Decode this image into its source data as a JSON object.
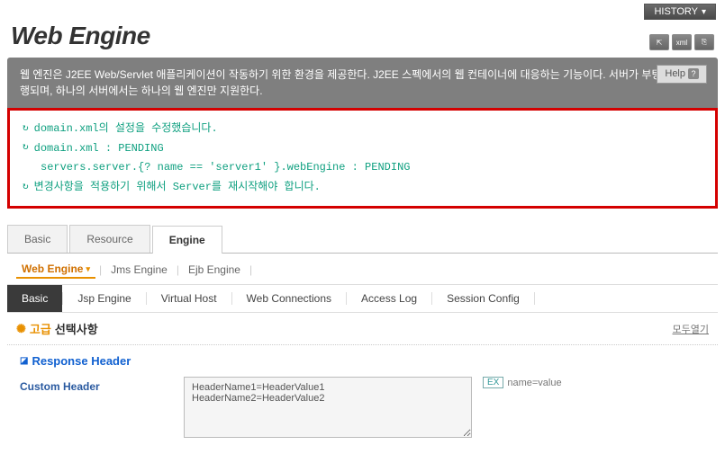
{
  "top": {
    "history": "HISTORY"
  },
  "page_title": "Web Engine",
  "description": "웹 엔진은 J2EE Web/Servlet 애플리케이션이 작동하기 위한 환경을 제공한다. J2EE 스펙에서의 웹 컨테이너에 대응하는 기능이다. 서버가 부팅될 때 실행되며, 하나의 서버에서는 하나의 웹 엔진만 지원한다.",
  "help_label": "Help",
  "messages": {
    "line1": "domain.xml의 설정을 수정했습니다.",
    "line2": "domain.xml : PENDING",
    "line3": "servers.server.{? name == 'server1' }.webEngine : PENDING",
    "line4": "변경사항을 적용하기 위해서 Server를 재시작해야 합니다."
  },
  "tabs1": {
    "basic": "Basic",
    "resource": "Resource",
    "engine": "Engine"
  },
  "tabs2": {
    "web": "Web Engine",
    "jms": "Jms Engine",
    "ejb": "Ejb Engine"
  },
  "tabs3": {
    "basic": "Basic",
    "jsp": "Jsp Engine",
    "vhost": "Virtual Host",
    "webconn": "Web Connections",
    "access": "Access Log",
    "session": "Session Config"
  },
  "section": {
    "advanced": "고급",
    "options": "선택사항",
    "expand_all": "모두열기"
  },
  "subsection": {
    "title": "Response Header"
  },
  "form": {
    "custom_header_label": "Custom Header",
    "custom_header_value": "HeaderName1=HeaderValue1\nHeaderName2=HeaderValue2",
    "example_badge": "EX",
    "example_text": "name=value"
  }
}
